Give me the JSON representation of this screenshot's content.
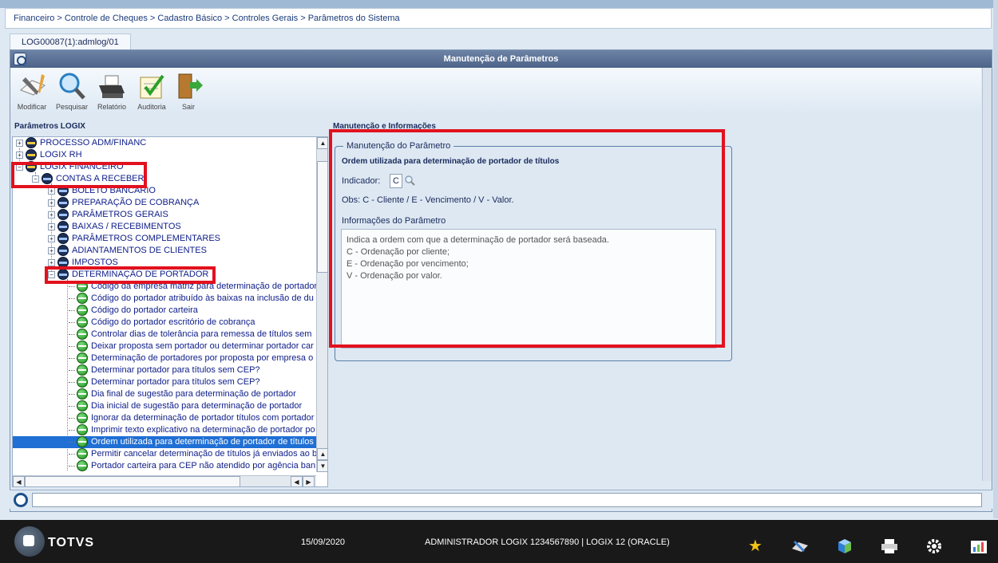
{
  "breadcrumb": "Financeiro > Controle de Cheques > Cadastro Básico > Controles Gerais > Parâmetros do Sistema",
  "tab": "LOG00087(1):admlog/01",
  "window_title": "Manutenção de Parâmetros",
  "toolbar": {
    "modificar": "Modificar",
    "pesquisar": "Pesquisar",
    "relatorio": "Relatório",
    "auditoria": "Auditoria",
    "sair": "Sair"
  },
  "left_title": "Parâmetros LOGIX",
  "right_title": "Manutenção e Informações",
  "tree": {
    "n0": "PROCESSO ADM/FINANC",
    "n1": "LOGIX RH",
    "n2": "LOGIX FINANCEIRO",
    "n3": "CONTAS A RECEBER",
    "n4": "BOLETO BANCÁRIO",
    "n5": "PREPARAÇÃO DE COBRANÇA",
    "n6": "PARÂMETROS GERAIS",
    "n7": "BAIXAS / RECEBIMENTOS",
    "n8": "PARÂMETROS COMPLEMENTARES",
    "n9": "ADIANTAMENTOS DE CLIENTES",
    "n10": "IMPOSTOS",
    "n11": "DETERMINAÇÃO DE PORTADOR",
    "l0": "Código da empresa matriz para determinação de portador",
    "l1": "Código do portador atribuído às baixas na inclusão de du",
    "l2": "Código do portador carteira",
    "l3": "Código do portador escritório de cobrança",
    "l4": "Controlar dias de tolerância para remessa de títulos sem",
    "l5": "Deixar proposta sem portador ou determinar portador car",
    "l6": "Determinação de portadores por proposta por empresa o",
    "l7": "Determinar portador para títulos sem CEP?",
    "l8": "Determinar portador para títulos sem CEP?",
    "l9": "Dia final de sugestão para determinação de portador",
    "l10": "Dia inicial de sugestão para determinação de portador",
    "l11": "Ignorar da determinação de portador títulos com portador",
    "l12": "Imprimir texto explicativo na determinação de portador po",
    "l13": "Ordem utilizada para determinação de portador de títulos",
    "l14": "Permitir cancelar determinação de títulos já enviados ao b",
    "l15": "Portador carteira para CEP não atendido por agência ban"
  },
  "param": {
    "legend": "Manutenção do Parâmetro",
    "description": "Ordem utilizada para determinação de portador de títulos",
    "indicator_label": "Indicador:",
    "indicator_value": "C",
    "obs": "Obs: C - Cliente / E - Vencimento / V - Valor.",
    "info_label": "Informações do Parâmetro",
    "info_text": "Indica a ordem com que a determinação de portador será baseada.\nC - Ordenação por cliente;\nE - Ordenação por vencimento;\nV - Ordenação por valor."
  },
  "footer": {
    "brand": "TOTVS",
    "date": "15/09/2020",
    "user": "ADMINISTRADOR LOGIX 1234567890 | LOGIX 12 (ORACLE)"
  },
  "colors": {
    "highlight": "#e2111e",
    "selection": "#1f6fd4",
    "title_bar": "#4d6388"
  }
}
